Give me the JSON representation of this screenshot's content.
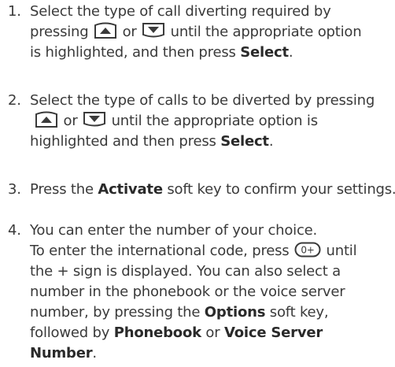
{
  "steps": [
    {
      "number": "1.",
      "line1": "Select the type of call diverting required by",
      "line2_pre": "pressing ",
      "or": "or",
      "line2_post": " until the appropriate option",
      "line3_pre": "is highlighted, and then press ",
      "line3_bold": "Select",
      "line3_end": "."
    },
    {
      "number": "2.",
      "line1": "Select the type of calls to be diverted by pressing",
      "or": "or",
      "line2_post": " until the appropriate option is",
      "line3_pre": "highlighted and then press ",
      "line3_bold": "Select",
      "line3_end": "."
    },
    {
      "number": "3.",
      "line1_pre": "Press the ",
      "line1_bold": "Activate",
      "line1_post": " soft key to confirm your settings."
    },
    {
      "number": "4.",
      "line1": "You can enter the number of your choice.",
      "line2_pre": "To enter the international code, press ",
      "line2_post": " until",
      "line3": "the + sign is displayed. You can also select a",
      "line4": "number in the phonebook or the voice server",
      "line5_pre": "number, by pressing the ",
      "line5_bold": "Options",
      "line5_post": " soft key,",
      "line6_pre": "followed by ",
      "line6_bold1": "Phonebook",
      "line6_mid": " or ",
      "line6_bold2": "Voice Server",
      "line7_bold": "Number",
      "line7_end": "."
    }
  ],
  "icons": {
    "up": "up-arrow-key-icon",
    "down": "down-arrow-key-icon",
    "zero_plus": "zero-plus-key-icon",
    "zero_label": "0+",
    "key_color": "#3a3a3a"
  }
}
